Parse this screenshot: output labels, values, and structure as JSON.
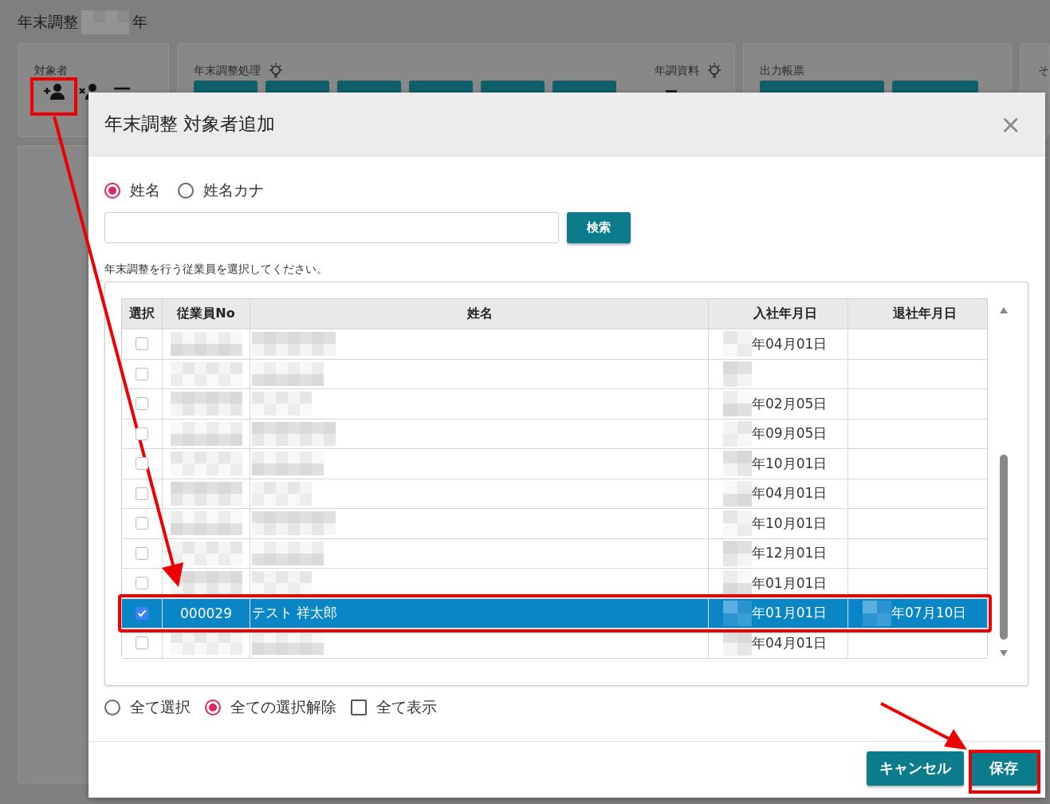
{
  "page": {
    "title": "年末調整",
    "title_suffix": "年",
    "panels": [
      {
        "kind": "target",
        "label": "対象者"
      },
      {
        "kind": "process",
        "label": "年末調整処理",
        "aside": "年調資料"
      },
      {
        "kind": "report",
        "label": "出力帳票"
      },
      {
        "kind": "other",
        "label": "そ"
      }
    ]
  },
  "dialog": {
    "title": "年末調整 対象者追加",
    "close": "×",
    "search_modes": [
      {
        "label": "姓名",
        "selected": true
      },
      {
        "label": "姓名カナ",
        "selected": false
      }
    ],
    "search_button": "検索",
    "hint": "年末調整を行う従業員を選択してください。",
    "table": {
      "columns": [
        "選択",
        "従業員No",
        "姓名",
        "入社年月日",
        "退社年月日"
      ],
      "rows": [
        {
          "selected": false,
          "hire_date": "年04月01日"
        },
        {
          "selected": false
        },
        {
          "selected": false,
          "hire_date": "年02月05日"
        },
        {
          "selected": false,
          "hire_date": "年09月05日"
        },
        {
          "selected": false,
          "hire_date": "年10月01日"
        },
        {
          "selected": false,
          "hire_date": "年04月01日"
        },
        {
          "selected": false,
          "hire_date": "年10月01日"
        },
        {
          "selected": false,
          "hire_date": "年12月01日"
        },
        {
          "selected": false,
          "hire_date": "年01月01日"
        },
        {
          "selected": true,
          "employee_no": "000029",
          "name": "テスト 祥太郎",
          "hire_date": "年01月01日",
          "retire_date": "年07月10日"
        },
        {
          "selected": false,
          "hire_date": "年04月01日"
        }
      ]
    },
    "options": [
      {
        "kind": "radio",
        "label": "全て選択",
        "selected": false
      },
      {
        "kind": "radio",
        "label": "全ての選択解除",
        "selected": true
      },
      {
        "kind": "checkbox",
        "label": "全て表示",
        "checked": false
      }
    ],
    "buttons": [
      {
        "kind": "secondary",
        "label": "キャンセル"
      },
      {
        "kind": "primary",
        "label": "保存"
      }
    ]
  }
}
